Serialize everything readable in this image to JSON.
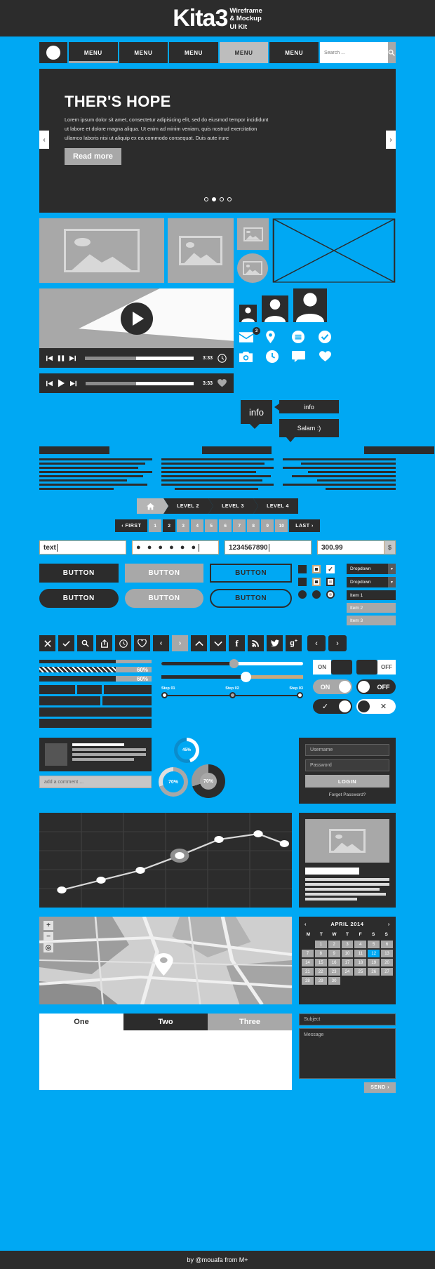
{
  "banner": {
    "logo": "Kita3",
    "sub_line1": "Wireframe",
    "sub_line2": "& Mockup",
    "sub_line3": "UI Kit"
  },
  "nav": {
    "items": [
      {
        "label": "MENU"
      },
      {
        "label": "MENU"
      },
      {
        "label": "MENU"
      },
      {
        "label": "MENU"
      },
      {
        "label": "MENU"
      }
    ],
    "search_placeholder": "Search ...",
    "search_icon": "search-icon"
  },
  "hero": {
    "title": "THER'S HOPE",
    "body": "Lorem ipsum dolor sit amet, consectetur adipisicing elit, sed do eiusmod tempor incididunt ut labore et dolore magna aliqua. Ut enim ad minim veniam, quis nostrud exercitation ullamco laboris nisi ut aliquip ex ea commodo consequat. Duis aute irure",
    "cta": "Read more",
    "prev": "‹",
    "next": "›",
    "dots_total": 4,
    "dots_active": 2
  },
  "player": {
    "time_top": "3:33",
    "time_bottom": "3:33",
    "progress_percent": 47
  },
  "tooltips": {
    "tip1": "info",
    "tip2": "info",
    "tip3": "Salam :)"
  },
  "breadcrumb": {
    "home_icon": "home-icon",
    "items": [
      "LEVEL 2",
      "LEVEL 3",
      "LEVEL 4"
    ]
  },
  "pagination": {
    "first": "‹ FIRST",
    "last": "LAST ›",
    "pages": [
      "1",
      "2",
      "3",
      "4",
      "5",
      "6",
      "7",
      "8",
      "9",
      "10"
    ],
    "active": "2"
  },
  "inputs": {
    "text_value": "text",
    "password_value": "● ● ● ● ● ●",
    "number_value": "1234567890",
    "currency_value": "300.99",
    "currency_suffix": "$"
  },
  "buttons": {
    "row1": [
      "BUTTON",
      "BUTTON",
      "BUTTON"
    ],
    "row2": [
      "BUTTON",
      "BUTTON",
      "BUTTON"
    ]
  },
  "dropdowns": {
    "items": [
      {
        "label": "Dropdown"
      },
      {
        "label": "Dropdown"
      }
    ],
    "list": [
      {
        "label": "Item 1",
        "selected": true
      },
      {
        "label": "Item 2",
        "selected": false
      },
      {
        "label": "Item 3",
        "selected": false
      }
    ]
  },
  "icon_bar": [
    "close-icon",
    "check-icon",
    "search-icon",
    "share-icon",
    "clock-icon",
    "heart-icon",
    "chevron-left-icon",
    "chevron-right-icon",
    "chevron-up-icon",
    "chevron-down-icon",
    "facebook-icon",
    "rss-icon",
    "twitter-icon",
    "google-plus-icon",
    "arrow-left-icon",
    "arrow-right-icon"
  ],
  "progress": {
    "bar1_percent": 68,
    "bar2_label": "60%",
    "bar3_label": "60%"
  },
  "sliders": {
    "slider1_percent": 52,
    "slider2_percent": 62,
    "steps": [
      "Step 01",
      "Step 02",
      "Step 03"
    ]
  },
  "toggles": {
    "on_label": "ON",
    "off_label": "OFF",
    "pill_on": "ON",
    "pill_off": "OFF",
    "check_icon": "check-icon",
    "cross_icon": "close-icon"
  },
  "comment": {
    "placeholder": "add a comment ..."
  },
  "donuts": [
    {
      "label": "45%",
      "value": 45
    },
    {
      "label": "70%",
      "value": 70
    },
    {
      "label": "70%",
      "value": 70
    }
  ],
  "login": {
    "username_placeholder": "Username",
    "password_placeholder": "Password",
    "submit": "LOGIN",
    "forgot": "Forget Password?"
  },
  "chart_data": {
    "type": "line",
    "title": "",
    "xlabel": "",
    "ylabel": "",
    "x": [
      0,
      1,
      2,
      3,
      4,
      5,
      6
    ],
    "values": [
      12,
      28,
      36,
      55,
      74,
      82,
      70
    ],
    "ylim": [
      0,
      100
    ],
    "grid": true,
    "legend": "none",
    "highlight_index": 3,
    "line_color": "#e0e0e0",
    "point_color": "#ffffff"
  },
  "map": {
    "zoom_in": "+",
    "zoom_out": "−",
    "locate_icon": "locate-icon",
    "pin_icon": "map-pin-icon"
  },
  "calendar": {
    "prev": "‹",
    "next": "›",
    "title": "APRIL 2014",
    "dow": [
      "M",
      "T",
      "W",
      "T",
      "F",
      "S",
      "S"
    ],
    "leading_blanks": 1,
    "days": [
      "1",
      "2",
      "3",
      "4",
      "5",
      "6",
      "7",
      "8",
      "9",
      "10",
      "11",
      "12",
      "13",
      "14",
      "15",
      "16",
      "17",
      "18",
      "19",
      "20",
      "21",
      "22",
      "23",
      "24",
      "25",
      "26",
      "27",
      "28",
      "29",
      "30"
    ],
    "selected": "12"
  },
  "tabs": {
    "items": [
      "One",
      "Two",
      "Three"
    ],
    "active": "One"
  },
  "contact_form": {
    "subject_placeholder": "Subject",
    "message_placeholder": "Message",
    "send": "SEND ›"
  },
  "footer": {
    "text": "by @mouafa from M+"
  },
  "colors": {
    "accent": "#00a8f3",
    "dark": "#2c2c2c",
    "grey": "#a8a8a8",
    "white": "#ffffff"
  }
}
